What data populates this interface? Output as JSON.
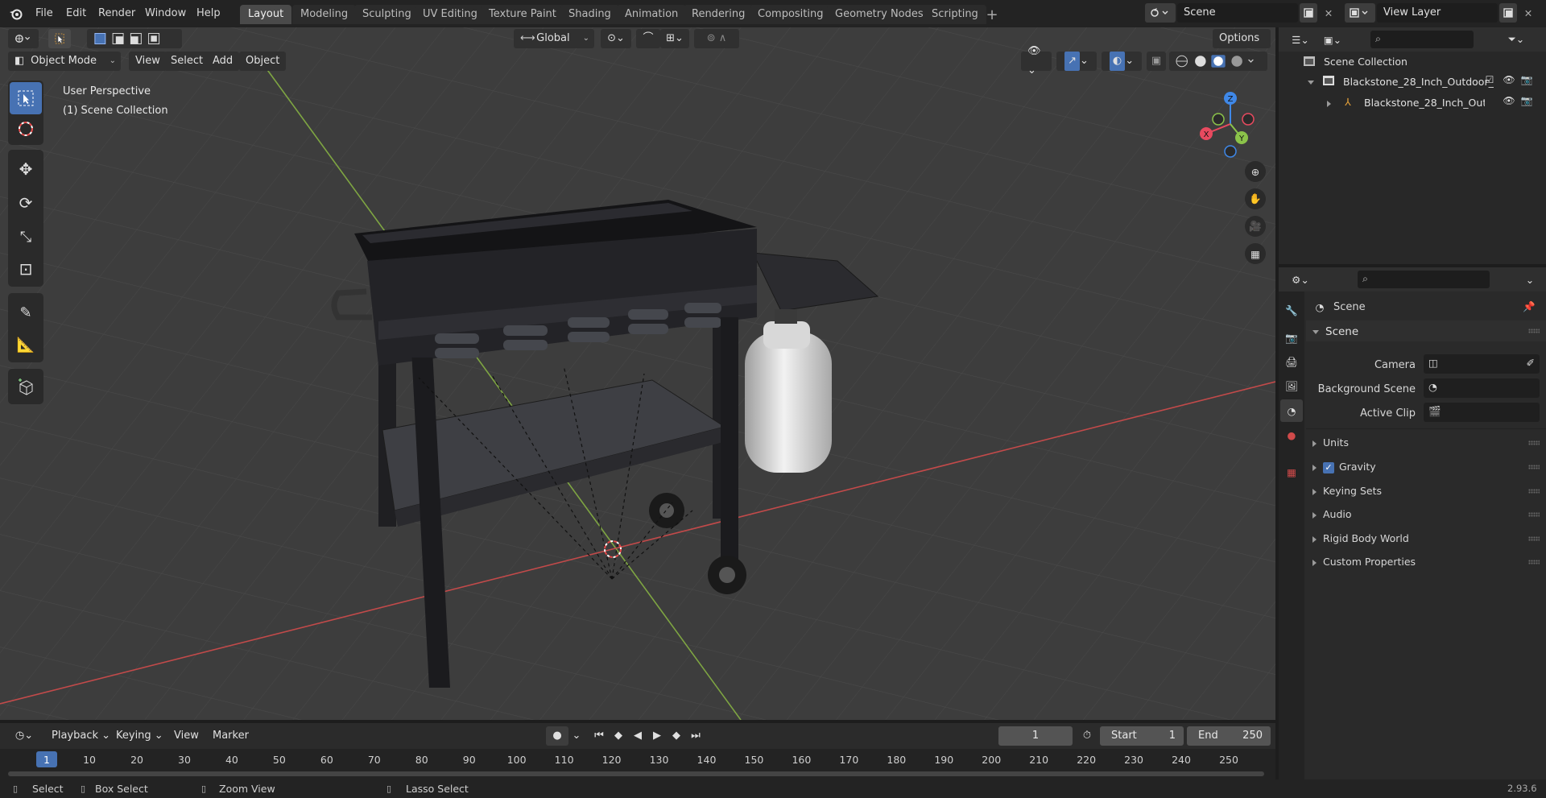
{
  "app": {
    "menus": [
      "File",
      "Edit",
      "Render",
      "Window",
      "Help"
    ],
    "workspaces": [
      "Layout",
      "Modeling",
      "Sculpting",
      "UV Editing",
      "Texture Paint",
      "Shading",
      "Animation",
      "Rendering",
      "Compositing",
      "Geometry Nodes",
      "Scripting"
    ],
    "active_workspace": "Layout",
    "scene_name": "Scene",
    "view_layer": "View Layer"
  },
  "header": {
    "transform_orientation": "Global",
    "options_label": "Options",
    "mode": "Object Mode",
    "menus": [
      "View",
      "Select",
      "Add",
      "Object"
    ]
  },
  "viewport": {
    "perspective_label": "User Perspective",
    "collection_label": "(1) Scene Collection",
    "gizmo_axes": [
      "X",
      "Y",
      "Z"
    ]
  },
  "outliner": {
    "root": "Scene Collection",
    "items": [
      {
        "label": "Blackstone_28_Inch_Outdoor_"
      },
      {
        "label": "Blackstone_28_Inch_Outd"
      }
    ]
  },
  "properties": {
    "context_label": "Scene",
    "panel_title": "Scene",
    "fields": [
      {
        "label": "Camera"
      },
      {
        "label": "Background Scene"
      },
      {
        "label": "Active Clip"
      }
    ],
    "subpanels": [
      "Units",
      "Gravity",
      "Keying Sets",
      "Audio",
      "Rigid Body World",
      "Custom Properties"
    ]
  },
  "timeline": {
    "menus": [
      "Playback",
      "Keying",
      "View",
      "Marker"
    ],
    "current_frame": "1",
    "start_label": "Start",
    "start_value": "1",
    "end_label": "End",
    "end_value": "250",
    "ruler": [
      "1",
      "10",
      "20",
      "30",
      "40",
      "50",
      "60",
      "70",
      "80",
      "90",
      "100",
      "110",
      "120",
      "130",
      "140",
      "150",
      "160",
      "170",
      "180",
      "190",
      "200",
      "210",
      "220",
      "230",
      "240",
      "250"
    ]
  },
  "statusbar": {
    "select": "Select",
    "box_select": "Box Select",
    "zoom_view": "Zoom View",
    "lasso_select": "Lasso Select",
    "version": "2.93.6"
  },
  "colors": {
    "accent": "#4772b3",
    "x_axis": "#e84a5f",
    "y_axis": "#8bc34a",
    "z_axis": "#3f88e8"
  }
}
